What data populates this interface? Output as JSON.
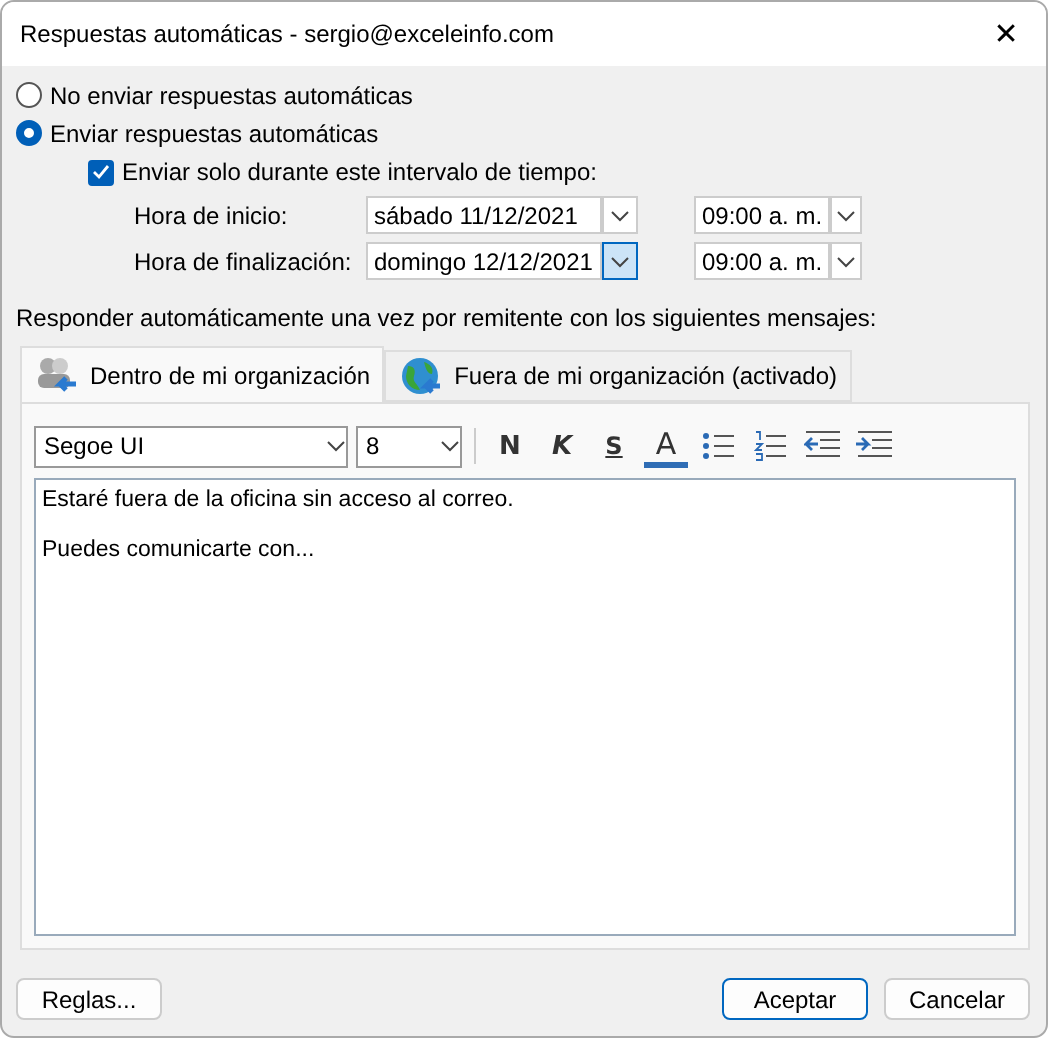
{
  "window": {
    "title": "Respuestas automáticas - sergio@exceleinfo.com",
    "close": "✕"
  },
  "reply_mode": [
    {
      "label": "No enviar respuestas automáticas",
      "selected": false
    },
    {
      "label": "Enviar respuestas automáticas",
      "selected": true
    }
  ],
  "time_range": {
    "label": "Enviar solo durante este intervalo de tiempo:",
    "checked": true,
    "rows": [
      {
        "label": "Hora de inicio:",
        "date": "sábado 11/12/2021",
        "time": "09:00 a. m.",
        "focused": false
      },
      {
        "label": "Hora de finalización:",
        "date": "domingo 12/12/2021",
        "time": "09:00 a. m.",
        "focused": true
      }
    ]
  },
  "instructions": "Responder automáticamente una vez por remitente con los siguientes mensajes:",
  "tabs": [
    {
      "label": "Dentro de mi organización",
      "kind": "people",
      "selected": true
    },
    {
      "label": "Fuera de mi organización (activado)",
      "kind": "globe",
      "selected": false
    }
  ],
  "toolbar": {
    "font": "Segoe UI",
    "size": "8",
    "buttons": [
      {
        "kind": "bold",
        "label": "N"
      },
      {
        "kind": "italic",
        "label": "K"
      },
      {
        "kind": "underline",
        "label": "S"
      },
      {
        "kind": "color",
        "label": "A"
      },
      {
        "kind": "bullets"
      },
      {
        "kind": "numbering"
      },
      {
        "kind": "outdent"
      },
      {
        "kind": "indent"
      }
    ]
  },
  "message": [
    "Estaré fuera de la oficina sin acceso al correo.",
    "Puedes comunicarte con..."
  ],
  "buttons": [
    {
      "label": "Reglas...",
      "kind": "left",
      "default": false
    },
    {
      "label": "Aceptar",
      "kind": "right",
      "default": true
    },
    {
      "label": "Cancelar",
      "kind": "right",
      "default": false
    }
  ]
}
